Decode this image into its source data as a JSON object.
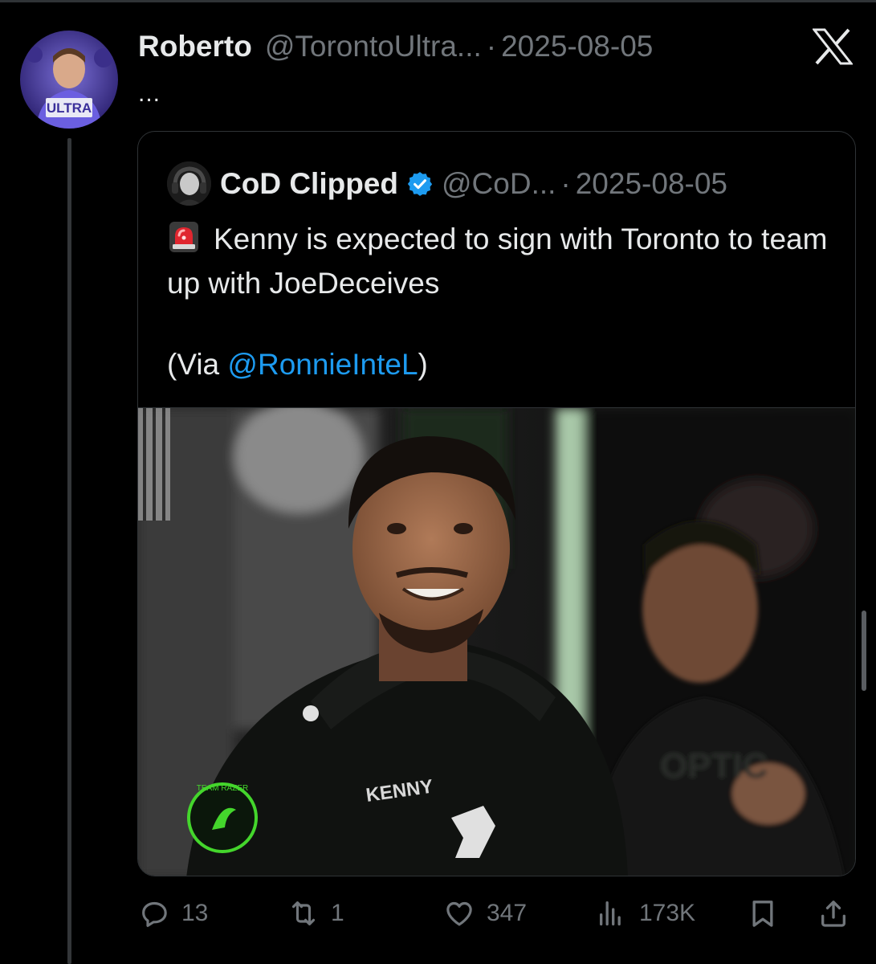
{
  "post": {
    "author_name": "Roberto",
    "author_handle": "@TorontoUltra...",
    "dot": "·",
    "date": "2025-08-05",
    "more_label": "...",
    "avatar_text": "ULTRA"
  },
  "quoted": {
    "author_name": "CoD Clipped",
    "author_handle": "@CoD...",
    "dot": "·",
    "date": "2025-08-05",
    "text": "Kenny is expected to sign with Toronto to team up with JoeDeceives",
    "via_prefix": "(Via ",
    "via_mention": "@RonnieInteL",
    "via_suffix": ")",
    "photo_jersey_text": "KENNY",
    "photo_patch_text": "TEAM RAZER"
  },
  "actions": {
    "replies": "13",
    "reposts": "1",
    "likes": "347",
    "views": "173K"
  },
  "icons": [
    "reply-icon",
    "repost-icon",
    "like-icon",
    "views-icon",
    "bookmark-icon",
    "share-icon",
    "x-logo-icon",
    "verified-badge-icon",
    "siren-icon"
  ],
  "colors": {
    "background": "#000000",
    "text": "#e7e9ea",
    "muted": "#71767b",
    "link": "#1d9bf0",
    "border": "#2f3336"
  }
}
